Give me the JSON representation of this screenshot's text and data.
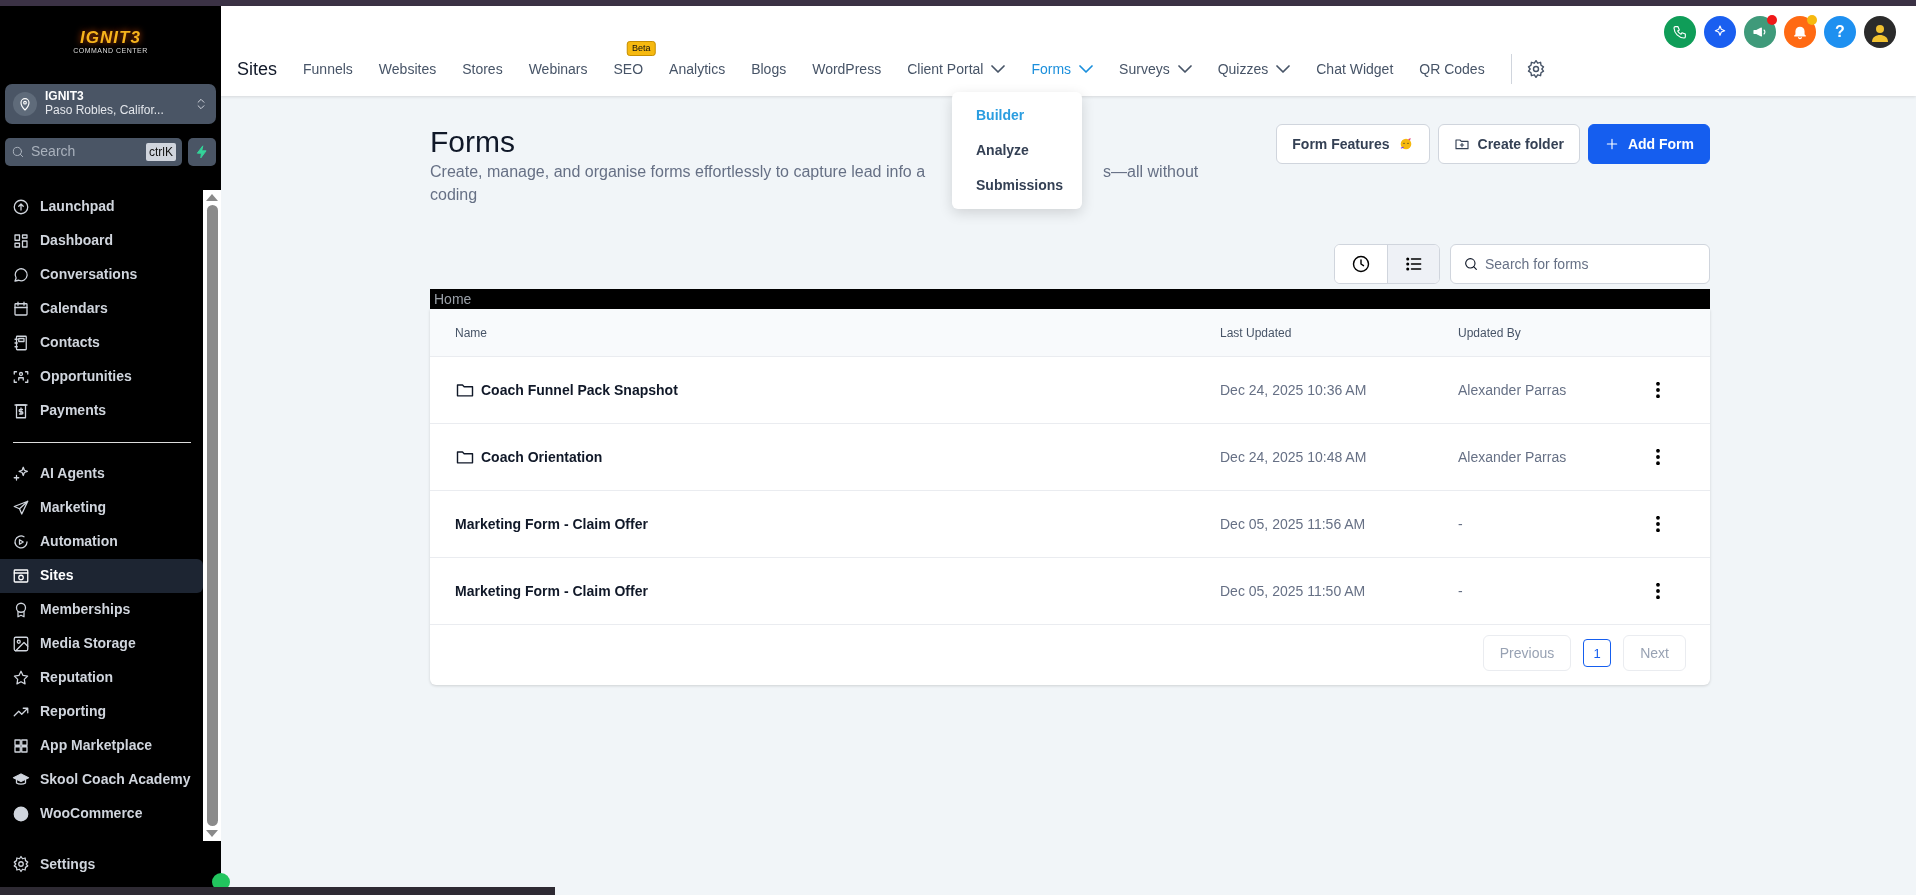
{
  "sidebar": {
    "logo": {
      "title": "IGNIT3",
      "subtitle": "COMMAND CENTER"
    },
    "account": {
      "name": "IGNIT3",
      "location": "Paso Robles, Califor..."
    },
    "search": {
      "placeholder": "Search",
      "shortcut": "ctrlK"
    },
    "groups": [
      [
        {
          "label": "Launchpad",
          "selected": false
        },
        {
          "label": "Dashboard",
          "selected": false
        },
        {
          "label": "Conversations",
          "selected": false
        },
        {
          "label": "Calendars",
          "selected": false
        },
        {
          "label": "Contacts",
          "selected": false
        },
        {
          "label": "Opportunities",
          "selected": false
        },
        {
          "label": "Payments",
          "selected": false
        }
      ],
      [
        {
          "label": "AI Agents",
          "selected": false
        },
        {
          "label": "Marketing",
          "selected": false
        },
        {
          "label": "Automation",
          "selected": false
        },
        {
          "label": "Sites",
          "selected": true
        },
        {
          "label": "Memberships",
          "selected": false
        },
        {
          "label": "Media Storage",
          "selected": false
        },
        {
          "label": "Reputation",
          "selected": false
        },
        {
          "label": "Reporting",
          "selected": false
        },
        {
          "label": "App Marketplace",
          "selected": false
        },
        {
          "label": "Skool Coach Academy",
          "selected": false
        },
        {
          "label": "WooCommerce",
          "selected": false
        }
      ]
    ],
    "settings": {
      "label": "Settings"
    }
  },
  "header_icons": [
    {
      "kind": "phone",
      "color": "#0f9d58"
    },
    {
      "kind": "sparkle",
      "color": "#1a5ff0"
    },
    {
      "kind": "megaphone",
      "color": "#3f9a7a",
      "indicator": {
        "color": "#f01818"
      }
    },
    {
      "kind": "bell",
      "color": "#ff6a13",
      "indicator": {
        "color": "#f6b90f"
      }
    },
    {
      "kind": "help",
      "label": "?",
      "color": "#1e90f0"
    },
    {
      "kind": "avatar",
      "color": "#2b2b2b"
    }
  ],
  "topnav": {
    "section": "Sites",
    "items": [
      {
        "label": "Funnels",
        "selected": false,
        "has_menu": false
      },
      {
        "label": "Websites",
        "selected": false,
        "has_menu": false
      },
      {
        "label": "Stores",
        "selected": false,
        "has_menu": false
      },
      {
        "label": "Webinars",
        "selected": false,
        "has_menu": false
      },
      {
        "label": "SEO",
        "selected": false,
        "has_menu": false,
        "badge": "Beta"
      },
      {
        "label": "Analytics",
        "selected": false,
        "has_menu": false
      },
      {
        "label": "Blogs",
        "selected": false,
        "has_menu": false
      },
      {
        "label": "WordPress",
        "selected": false,
        "has_menu": false
      },
      {
        "label": "Client Portal",
        "selected": false,
        "has_menu": true
      },
      {
        "label": "Forms",
        "selected": true,
        "has_menu": true
      },
      {
        "label": "Surveys",
        "selected": false,
        "has_menu": true
      },
      {
        "label": "Quizzes",
        "selected": false,
        "has_menu": true
      },
      {
        "label": "Chat Widget",
        "selected": false,
        "has_menu": false
      },
      {
        "label": "QR Codes",
        "selected": false,
        "has_menu": false
      }
    ]
  },
  "forms_menu": {
    "items": [
      {
        "label": "Builder",
        "selected": true
      },
      {
        "label": "Analyze",
        "selected": false
      },
      {
        "label": "Submissions",
        "selected": false
      }
    ]
  },
  "page": {
    "title": "Forms",
    "description_lines": [
      [
        "Create, manage, and organise forms effortlessly to capture lead info a",
        "s—all without"
      ],
      [
        "coding"
      ]
    ],
    "buttons": [
      {
        "kind": "features",
        "label": "Form Features"
      },
      {
        "kind": "folder",
        "label": "Create folder"
      },
      {
        "kind": "add",
        "label": "Add Form"
      }
    ]
  },
  "toolbar": {
    "views": [
      {
        "kind": "recent",
        "selected": false
      },
      {
        "kind": "list",
        "selected": true
      }
    ],
    "search": {
      "placeholder": "Search for forms"
    }
  },
  "breadcrumb": "Home",
  "table": {
    "columns": [
      "Name",
      "Last Updated",
      "Updated By"
    ],
    "rows": [
      {
        "kind": "folder",
        "name": "Coach Funnel Pack Snapshot",
        "updated": "Dec 24, 2025 10:36 AM",
        "by": "Alexander Parras"
      },
      {
        "kind": "folder",
        "name": "Coach Orientation",
        "updated": "Dec 24, 2025 10:48 AM",
        "by": "Alexander Parras"
      },
      {
        "kind": "form",
        "name": "Marketing Form - Claim Offer",
        "updated": "Dec 05, 2025 11:56 AM",
        "by": "-"
      },
      {
        "kind": "form",
        "name": "Marketing Form - Claim Offer",
        "updated": "Dec 05, 2025 11:50 AM",
        "by": "-"
      }
    ]
  },
  "pagination": {
    "previous": {
      "label": "Previous",
      "disabled": true
    },
    "pages": [
      {
        "label": "1",
        "selected": true
      }
    ],
    "next": {
      "label": "Next",
      "disabled": true
    }
  }
}
